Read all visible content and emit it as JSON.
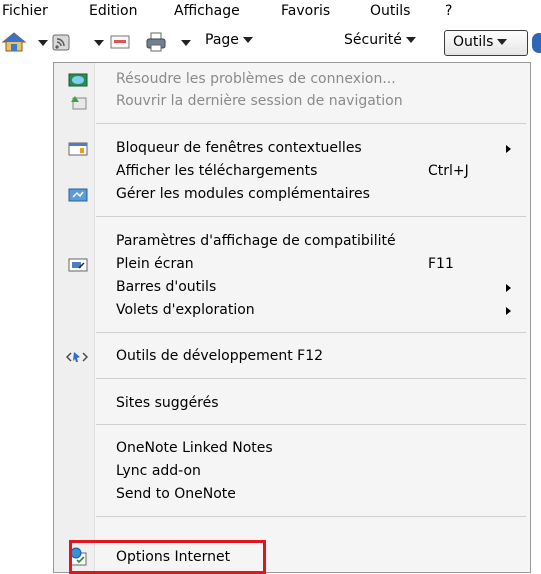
{
  "menubar": {
    "items": [
      {
        "label": "Fichier"
      },
      {
        "label": "Edition"
      },
      {
        "label": "Affichage"
      },
      {
        "label": "Favoris"
      },
      {
        "label": "Outils"
      },
      {
        "label": "?"
      }
    ]
  },
  "toolbar": {
    "home_icon": "home-icon",
    "feeds_icon": "feeds-icon",
    "mail_icon": "mail-icon",
    "print_icon": "print-icon",
    "page_label": "Page",
    "security_label": "Sécurité",
    "tools_label": "Outils"
  },
  "menu": {
    "items": [
      {
        "label": "Résoudre les problèmes de connexion...",
        "disabled": true,
        "icon": "network-diagnose-icon"
      },
      {
        "label": "Rouvrir la dernière session de navigation",
        "disabled": true,
        "icon": "reopen-session-icon"
      },
      {
        "label": "Bloqueur de fenêtres contextuelles",
        "submenu": true,
        "icon": "popup-blocker-icon"
      },
      {
        "label": "Afficher les téléchargements",
        "shortcut": "Ctrl+J"
      },
      {
        "label": "Gérer les modules complémentaires",
        "icon": "manage-addons-icon"
      },
      {
        "label": "Paramètres d'affichage de compatibilité"
      },
      {
        "label": "Plein écran",
        "shortcut": "F11",
        "icon": "fullscreen-icon"
      },
      {
        "label": "Barres d'outils",
        "submenu": true
      },
      {
        "label": "Volets d'exploration",
        "submenu": true
      },
      {
        "label": "Outils de développement F12",
        "icon": "developer-tools-icon"
      },
      {
        "label": "Sites suggérés"
      },
      {
        "label": "OneNote Linked Notes"
      },
      {
        "label": "Lync add-on"
      },
      {
        "label": "Send to OneNote"
      },
      {
        "label": "Options Internet",
        "icon": "internet-options-icon",
        "highlighted": true
      }
    ]
  },
  "colors": {
    "highlight_border": "#e0161f",
    "disabled_text": "#8a8a8a"
  }
}
